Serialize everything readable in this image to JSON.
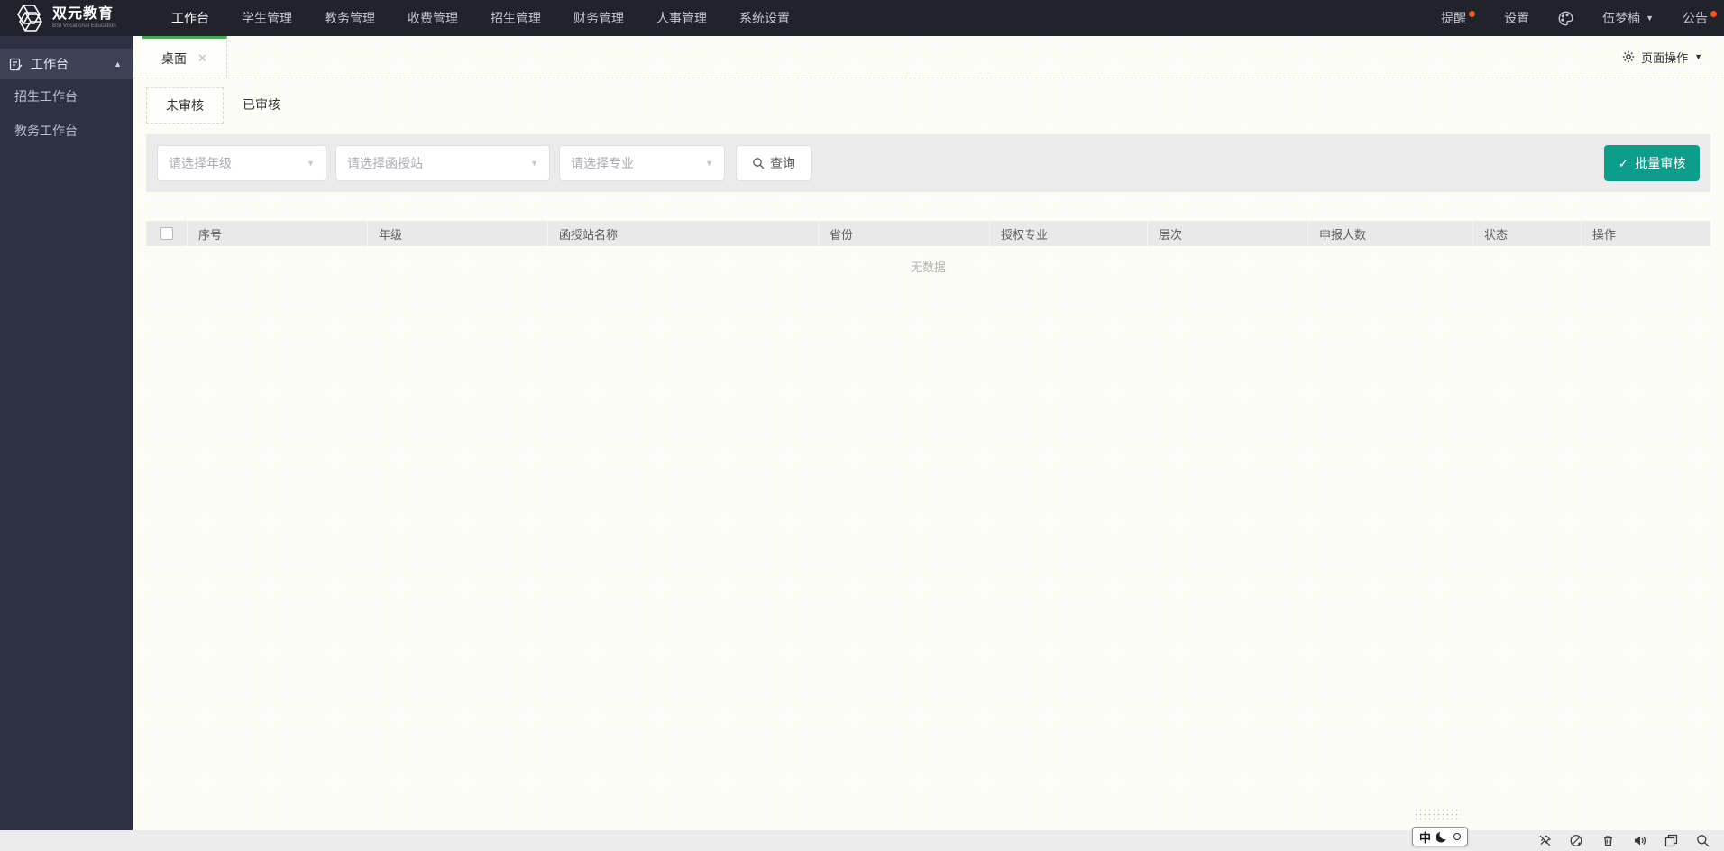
{
  "logo": {
    "title": "双元教育",
    "subtitle": "BSI Vocational Education"
  },
  "topnav": {
    "items": [
      "工作台",
      "学生管理",
      "教务管理",
      "收费管理",
      "招生管理",
      "财务管理",
      "人事管理",
      "系统设置"
    ],
    "active_item": "工作台",
    "right": {
      "remind": "提醒",
      "settings": "设置",
      "user": "伍梦楠",
      "notice": "公告"
    }
  },
  "sidebar": {
    "header": "工作台",
    "items": [
      {
        "label": "招生工作台"
      },
      {
        "label": "教务工作台"
      }
    ]
  },
  "tabstrip": {
    "tab": "桌面",
    "page_actions": "页面操作"
  },
  "subtabs": [
    {
      "label": "未审核",
      "active": true
    },
    {
      "label": "已审核",
      "active": false
    }
  ],
  "filters": {
    "selects": [
      {
        "placeholder": "请选择年级"
      },
      {
        "placeholder": "请选择函授站"
      },
      {
        "placeholder": "请选择专业"
      }
    ],
    "search_label": "查询",
    "batch_label": "批量审核"
  },
  "table": {
    "columns": [
      "序号",
      "年级",
      "函授站名称",
      "省份",
      "授权专业",
      "层次",
      "申报人数",
      "状态",
      "操作"
    ],
    "rows": [],
    "empty_text": "无数据"
  },
  "ime": {
    "lang": "中"
  },
  "icons": {
    "check": "✓",
    "caret_up": "▲",
    "caret_down": "▼",
    "close": "✕"
  },
  "colors": {
    "accent_green": "#47a854",
    "button_teal": "#0c9e8a",
    "badge_red": "#fa541c",
    "nav_bg": "#20222c",
    "sidebar_bg": "#2e3144"
  }
}
